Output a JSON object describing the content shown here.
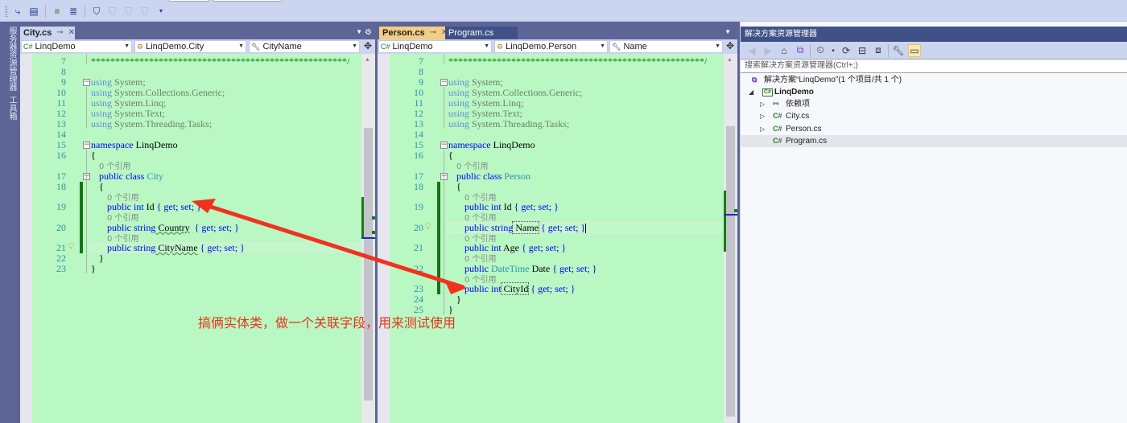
{
  "toolbar": {
    "icons": [
      "step-into-icon",
      "format-icon",
      "comment-icon",
      "uncomment-icon",
      "bookmark-icon",
      "prev-bookmark-icon",
      "next-bookmark-icon",
      "clear-bookmarks-icon",
      "overflow-icon"
    ]
  },
  "left_sidebar": {
    "tabs": [
      {
        "label": "服务器资源管理器"
      },
      {
        "label": "工具箱"
      }
    ]
  },
  "left_editor": {
    "tabs": [
      {
        "label": "City.cs",
        "active": true
      }
    ],
    "nav": {
      "project": "LinqDemo",
      "type": "LinqDemo.City",
      "member": "CityName"
    },
    "lines": [
      {
        "num": "7",
        "text": "*****************************************************/"
      },
      {
        "num": "8",
        "text": ""
      },
      {
        "num": "9",
        "kw": "using",
        "rest": " System;"
      },
      {
        "num": "10",
        "kw": "using",
        "rest": " System.Collections.Generic;"
      },
      {
        "num": "11",
        "kw": "using",
        "rest": " System.Linq;"
      },
      {
        "num": "12",
        "kw": "using",
        "rest": " System.Text;"
      },
      {
        "num": "13",
        "kw": "using",
        "rest": " System.Threading.Tasks;"
      },
      {
        "num": "14",
        "text": ""
      },
      {
        "num": "15",
        "kw": "namespace",
        "rest": " LinqDemo"
      },
      {
        "num": "16",
        "text": "{"
      },
      {
        "lens": "0 个引用"
      },
      {
        "num": "17",
        "kw": "public class",
        "type": " City"
      },
      {
        "num": "18",
        "text": "{"
      },
      {
        "lens": "0 个引用"
      },
      {
        "num": "19",
        "kw": "public int",
        "name": " Id",
        "acc": " { get; set; }"
      },
      {
        "lens": "0 个引用"
      },
      {
        "num": "20",
        "kw": "public string",
        "name": " Country",
        "acc": "  { get; set; }"
      },
      {
        "lens": "0 个引用"
      },
      {
        "num": "21",
        "kw": "public string",
        "name": " CityName",
        "acc": " { get; set; }"
      },
      {
        "num": "22",
        "text": "}"
      },
      {
        "num": "23",
        "text": "}"
      }
    ]
  },
  "right_editor": {
    "tabs": [
      {
        "label": "Person.cs",
        "active": true
      },
      {
        "label": "Program.cs",
        "active": false
      }
    ],
    "nav": {
      "project": "LinqDemo",
      "type": "LinqDemo.Person",
      "member": "Name"
    },
    "lines": [
      {
        "num": "7",
        "text": "*****************************************************/"
      },
      {
        "num": "8",
        "text": ""
      },
      {
        "num": "9",
        "kw": "using",
        "rest": " System;"
      },
      {
        "num": "10",
        "kw": "using",
        "rest": " System.Collections.Generic;"
      },
      {
        "num": "11",
        "kw": "using",
        "rest": " System.Linq;"
      },
      {
        "num": "12",
        "kw": "using",
        "rest": " System.Text;"
      },
      {
        "num": "13",
        "kw": "using",
        "rest": " System.Threading.Tasks;"
      },
      {
        "num": "14",
        "text": ""
      },
      {
        "num": "15",
        "kw": "namespace",
        "rest": " LinqDemo"
      },
      {
        "num": "16",
        "text": "{"
      },
      {
        "lens": "0 个引用"
      },
      {
        "num": "17",
        "kw": "public class",
        "type": " Person"
      },
      {
        "num": "18",
        "text": "{"
      },
      {
        "lens": "0 个引用"
      },
      {
        "num": "19",
        "kw": "public int",
        "name": " Id",
        "acc": " { get; set; }"
      },
      {
        "lens": "0 个引用"
      },
      {
        "num": "20",
        "kw": "public string",
        "name": " Name",
        "acc": " { get; set; }"
      },
      {
        "lens": "0 个引用"
      },
      {
        "num": "21",
        "kw": "public int",
        "name": " Age",
        "acc": " { get; set; }"
      },
      {
        "lens": "0 个引用"
      },
      {
        "num": "22",
        "kw": "public",
        "type": " DateTime",
        "name": " Date",
        "acc": " { get; set; }"
      },
      {
        "lens": "0 个引用"
      },
      {
        "num": "23",
        "kw": "public int",
        "name": " CityId",
        "acc": " { get; set; }"
      },
      {
        "num": "24",
        "text": "}"
      },
      {
        "num": "25",
        "text": "}"
      }
    ]
  },
  "solution_explorer": {
    "title": "解决方案资源管理器",
    "search_placeholder": "搜索解决方案资源管理器(Ctrl+;)",
    "tree": [
      {
        "label": "解决方案“LinqDemo”(1 个项目/共 1 个)",
        "icon": "solution-icon",
        "level": 0
      },
      {
        "label": "LinqDemo",
        "icon": "csharp-project-icon",
        "level": 1,
        "expanded": true,
        "bold": true
      },
      {
        "label": "依赖项",
        "icon": "dependencies-icon",
        "level": 2,
        "expandable": true
      },
      {
        "label": "City.cs",
        "icon": "csharp-file-icon",
        "level": 2,
        "expandable": true
      },
      {
        "label": "Person.cs",
        "icon": "csharp-file-icon",
        "level": 2,
        "expandable": true
      },
      {
        "label": "Program.cs",
        "icon": "csharp-file-icon",
        "level": 2,
        "selected": true
      }
    ]
  },
  "annotation": {
    "text": "搞俩实体类，做一个关联字段，用来测试使用",
    "color": "#e8331c"
  },
  "colors": {
    "code_bg": "#b9f8c2",
    "chrome": "#5c6596",
    "tab_active_bg": "#f5cc84",
    "title_bar": "#3f5187"
  }
}
